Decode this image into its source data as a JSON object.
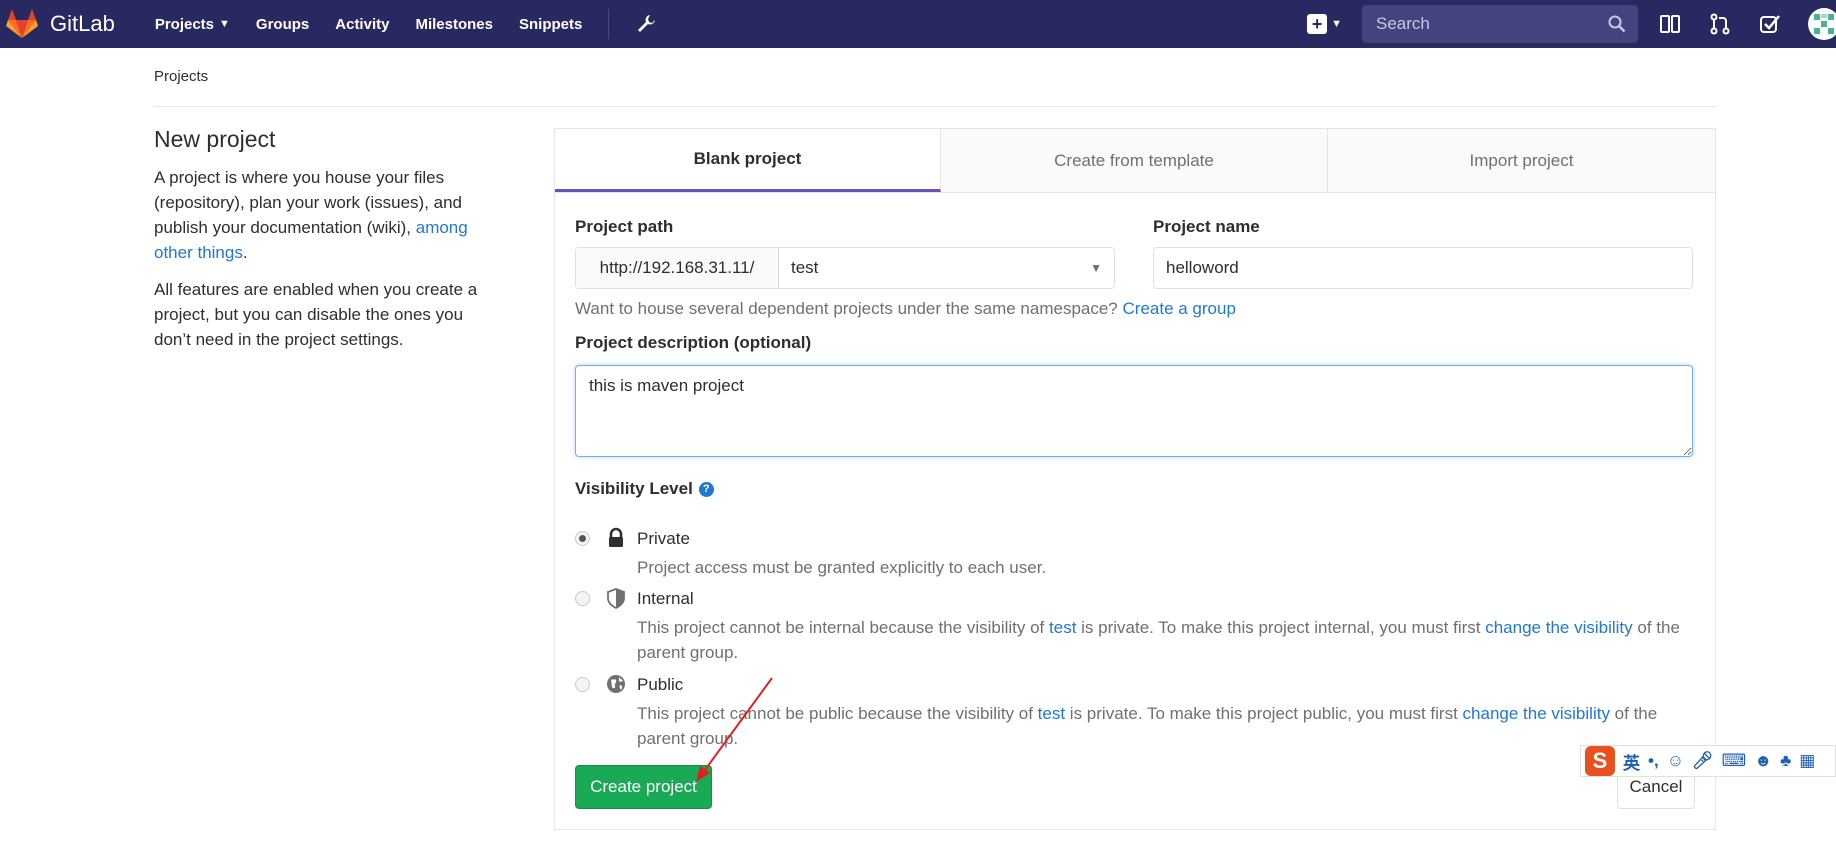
{
  "navbar": {
    "brand": "GitLab",
    "links": [
      {
        "label": "Projects",
        "has_caret": true
      },
      {
        "label": "Groups"
      },
      {
        "label": "Activity"
      },
      {
        "label": "Milestones"
      },
      {
        "label": "Snippets"
      }
    ],
    "search_placeholder": "Search"
  },
  "breadcrumb": "Projects",
  "intro": {
    "title": "New project",
    "p1_text": "A project is where you house your files (repository), plan your work (issues), and publish your documentation (wiki), ",
    "p1_link": "among other things",
    "p1_end": ".",
    "p2": "All features are enabled when you create a project, but you can disable the ones you don’t need in the project settings."
  },
  "tabs": [
    {
      "label": "Blank project",
      "active": true
    },
    {
      "label": "Create from template"
    },
    {
      "label": "Import project"
    }
  ],
  "form": {
    "path_label": "Project path",
    "path_prefix": "http://192.168.31.11/",
    "namespace": "test",
    "name_label": "Project name",
    "name_value": "helloword",
    "help_text": "Want to house several dependent projects under the same namespace? ",
    "help_link": "Create a group",
    "desc_label": "Project description (optional)",
    "desc_value": "this is maven project",
    "visibility_label": "Visibility Level",
    "visibility": [
      {
        "title": "Private",
        "desc": "Project access must be granted explicitly to each user.",
        "checked": true
      },
      {
        "title": "Internal",
        "desc_a": "This project cannot be internal because the visibility of ",
        "desc_link1": "test",
        "desc_b": " is private. To make this project internal, you must first ",
        "desc_link2": "change the visibility",
        "desc_c": " of the parent group."
      },
      {
        "title": "Public",
        "desc_a": "This project cannot be public because the visibility of ",
        "desc_link1": "test",
        "desc_b": " is private. To make this project public, you must first ",
        "desc_link2": "change the visibility",
        "desc_c": " of the parent group."
      }
    ],
    "create_label": "Create project",
    "cancel_label": "Cancel"
  },
  "ime": {
    "logo": "S",
    "mode": "英",
    "punct": "•,"
  },
  "colors": {
    "navbar": "#292961",
    "accent": "#6b4fbb",
    "success": "#1aaa55",
    "link": "#1f78d1"
  }
}
